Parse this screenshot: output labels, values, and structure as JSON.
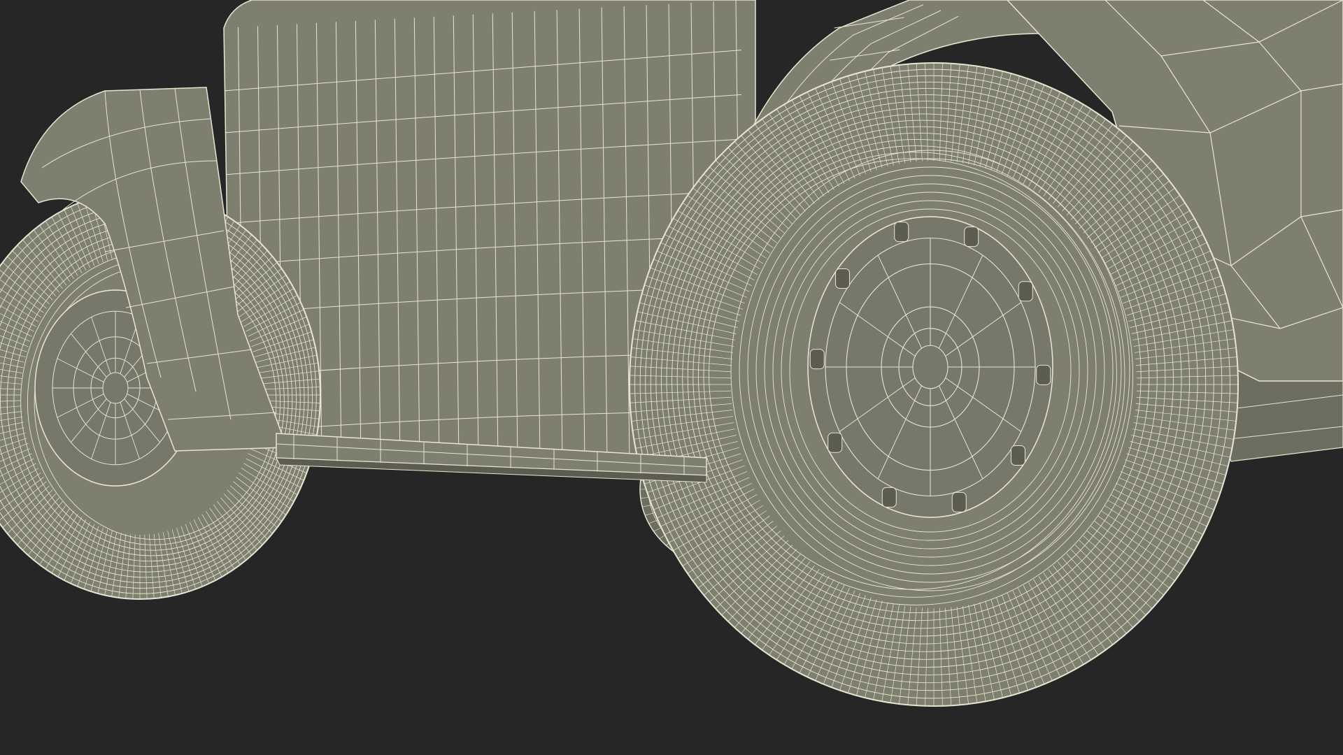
{
  "scene": {
    "colors": {
      "background": "#262626",
      "body_fill": "#7f7f6f",
      "body_fill_dark": "#6e6e60",
      "shadow_fill": "#5c5c50",
      "wire": "#e6e6d2",
      "wire_dense": "#d9d9c2"
    }
  }
}
